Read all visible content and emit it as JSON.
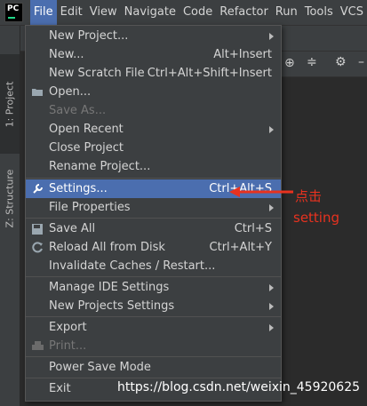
{
  "menubar": {
    "logo_text": "PC",
    "items": [
      "File",
      "Edit",
      "View",
      "Navigate",
      "Code",
      "Refactor",
      "Run",
      "Tools",
      "VCS"
    ]
  },
  "toolwindows": {
    "project_tab": "1: Project",
    "structure_tab": "Z: Structure"
  },
  "file_menu": {
    "new_project": "New Project...",
    "new": "New...",
    "new_shortcut": "Alt+Insert",
    "new_scratch_file": "New Scratch File",
    "new_scratch_shortcut": "Ctrl+Alt+Shift+Insert",
    "open": "Open...",
    "save_as": "Save As...",
    "open_recent": "Open Recent",
    "close_project": "Close Project",
    "rename_project": "Rename Project...",
    "settings": "Settings...",
    "settings_shortcut": "Ctrl+Alt+S",
    "file_properties": "File Properties",
    "save_all": "Save All",
    "save_all_shortcut": "Ctrl+S",
    "reload_all": "Reload All from Disk",
    "reload_shortcut": "Ctrl+Alt+Y",
    "invalidate_caches": "Invalidate Caches / Restart...",
    "manage_ide_settings": "Manage IDE Settings",
    "new_projects_settings": "New Projects Settings",
    "export": "Export",
    "print": "Print...",
    "power_save_mode": "Power Save Mode",
    "exit": "Exit"
  },
  "annotation": {
    "line1": "点击",
    "line2": "setting",
    "color": "#e8321f"
  },
  "watermark": "https://blog.csdn.net/weixin_45920625",
  "colors": {
    "menu_bg": "#3c3f41",
    "selection": "#4b6eaf",
    "editor_bg": "#2b2b2b"
  }
}
